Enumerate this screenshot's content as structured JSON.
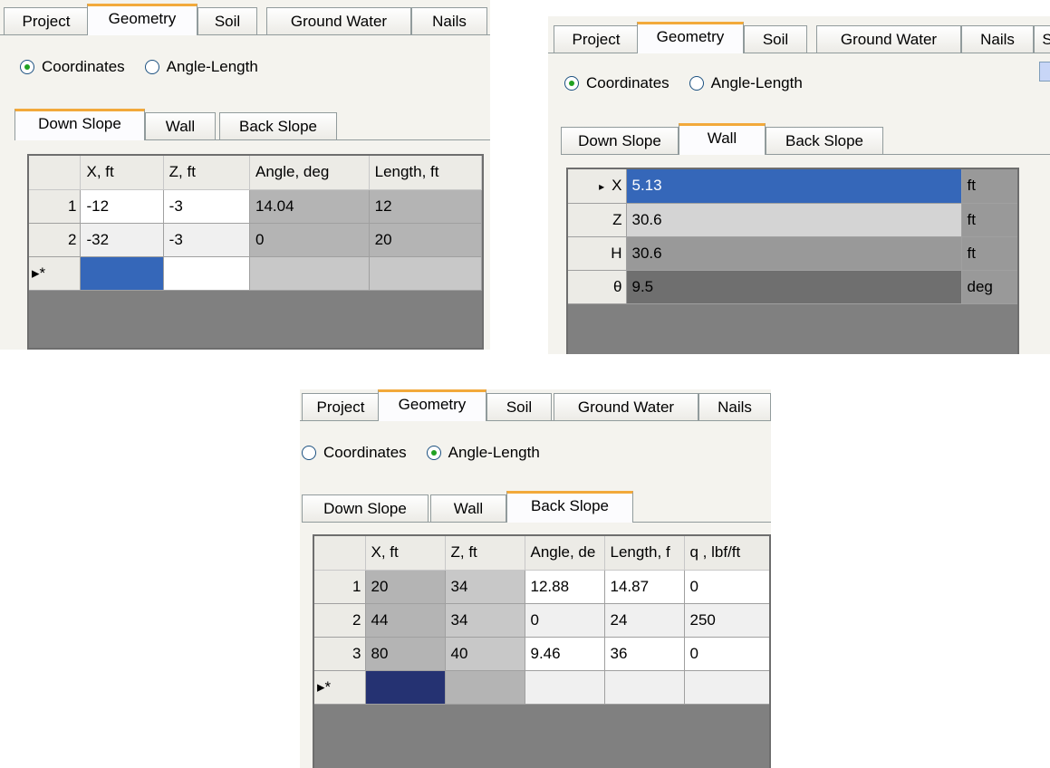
{
  "tabs": [
    "Project",
    "Geometry",
    "Soil",
    "Ground Water",
    "Nails"
  ],
  "panel2_extra_tab": "S",
  "radios": {
    "coordinates": "Coordinates",
    "angle_length": "Angle-Length"
  },
  "subtabs": [
    "Down Slope",
    "Wall",
    "Back Slope"
  ],
  "panel1": {
    "selected_mode": "Coordinates",
    "active_subtab": "Down Slope",
    "columns": [
      "X, ft",
      "Z, ft",
      "Angle, deg",
      "Length, ft"
    ],
    "rows": [
      {
        "n": "1",
        "cells": [
          "-12",
          "-3",
          "14.04",
          "12"
        ]
      },
      {
        "n": "2",
        "cells": [
          "-32",
          "-3",
          "0",
          "20"
        ]
      }
    ],
    "new_row_marker": "▸*"
  },
  "panel2": {
    "selected_mode": "Coordinates",
    "active_subtab": "Wall",
    "rows": [
      {
        "marker": "▸",
        "name": "X",
        "value": "5.13",
        "unit": "ft"
      },
      {
        "marker": "",
        "name": "Z",
        "value": "30.6",
        "unit": "ft"
      },
      {
        "marker": "",
        "name": "H",
        "value": "30.6",
        "unit": "ft"
      },
      {
        "marker": "",
        "name": "θ",
        "value": "9.5",
        "unit": "deg"
      }
    ]
  },
  "panel3": {
    "selected_mode": "Angle-Length",
    "active_subtab": "Back Slope",
    "columns": [
      "X, ft",
      "Z, ft",
      "Angle, de",
      "Length, f",
      "q , lbf/ft"
    ],
    "rows": [
      {
        "n": "1",
        "cells": [
          "20",
          "34",
          "12.88",
          "14.87",
          "0"
        ]
      },
      {
        "n": "2",
        "cells": [
          "44",
          "34",
          "0",
          "24",
          "250"
        ]
      },
      {
        "n": "3",
        "cells": [
          "80",
          "40",
          "9.46",
          "36",
          "0"
        ]
      }
    ],
    "new_row_marker": "▸*"
  }
}
